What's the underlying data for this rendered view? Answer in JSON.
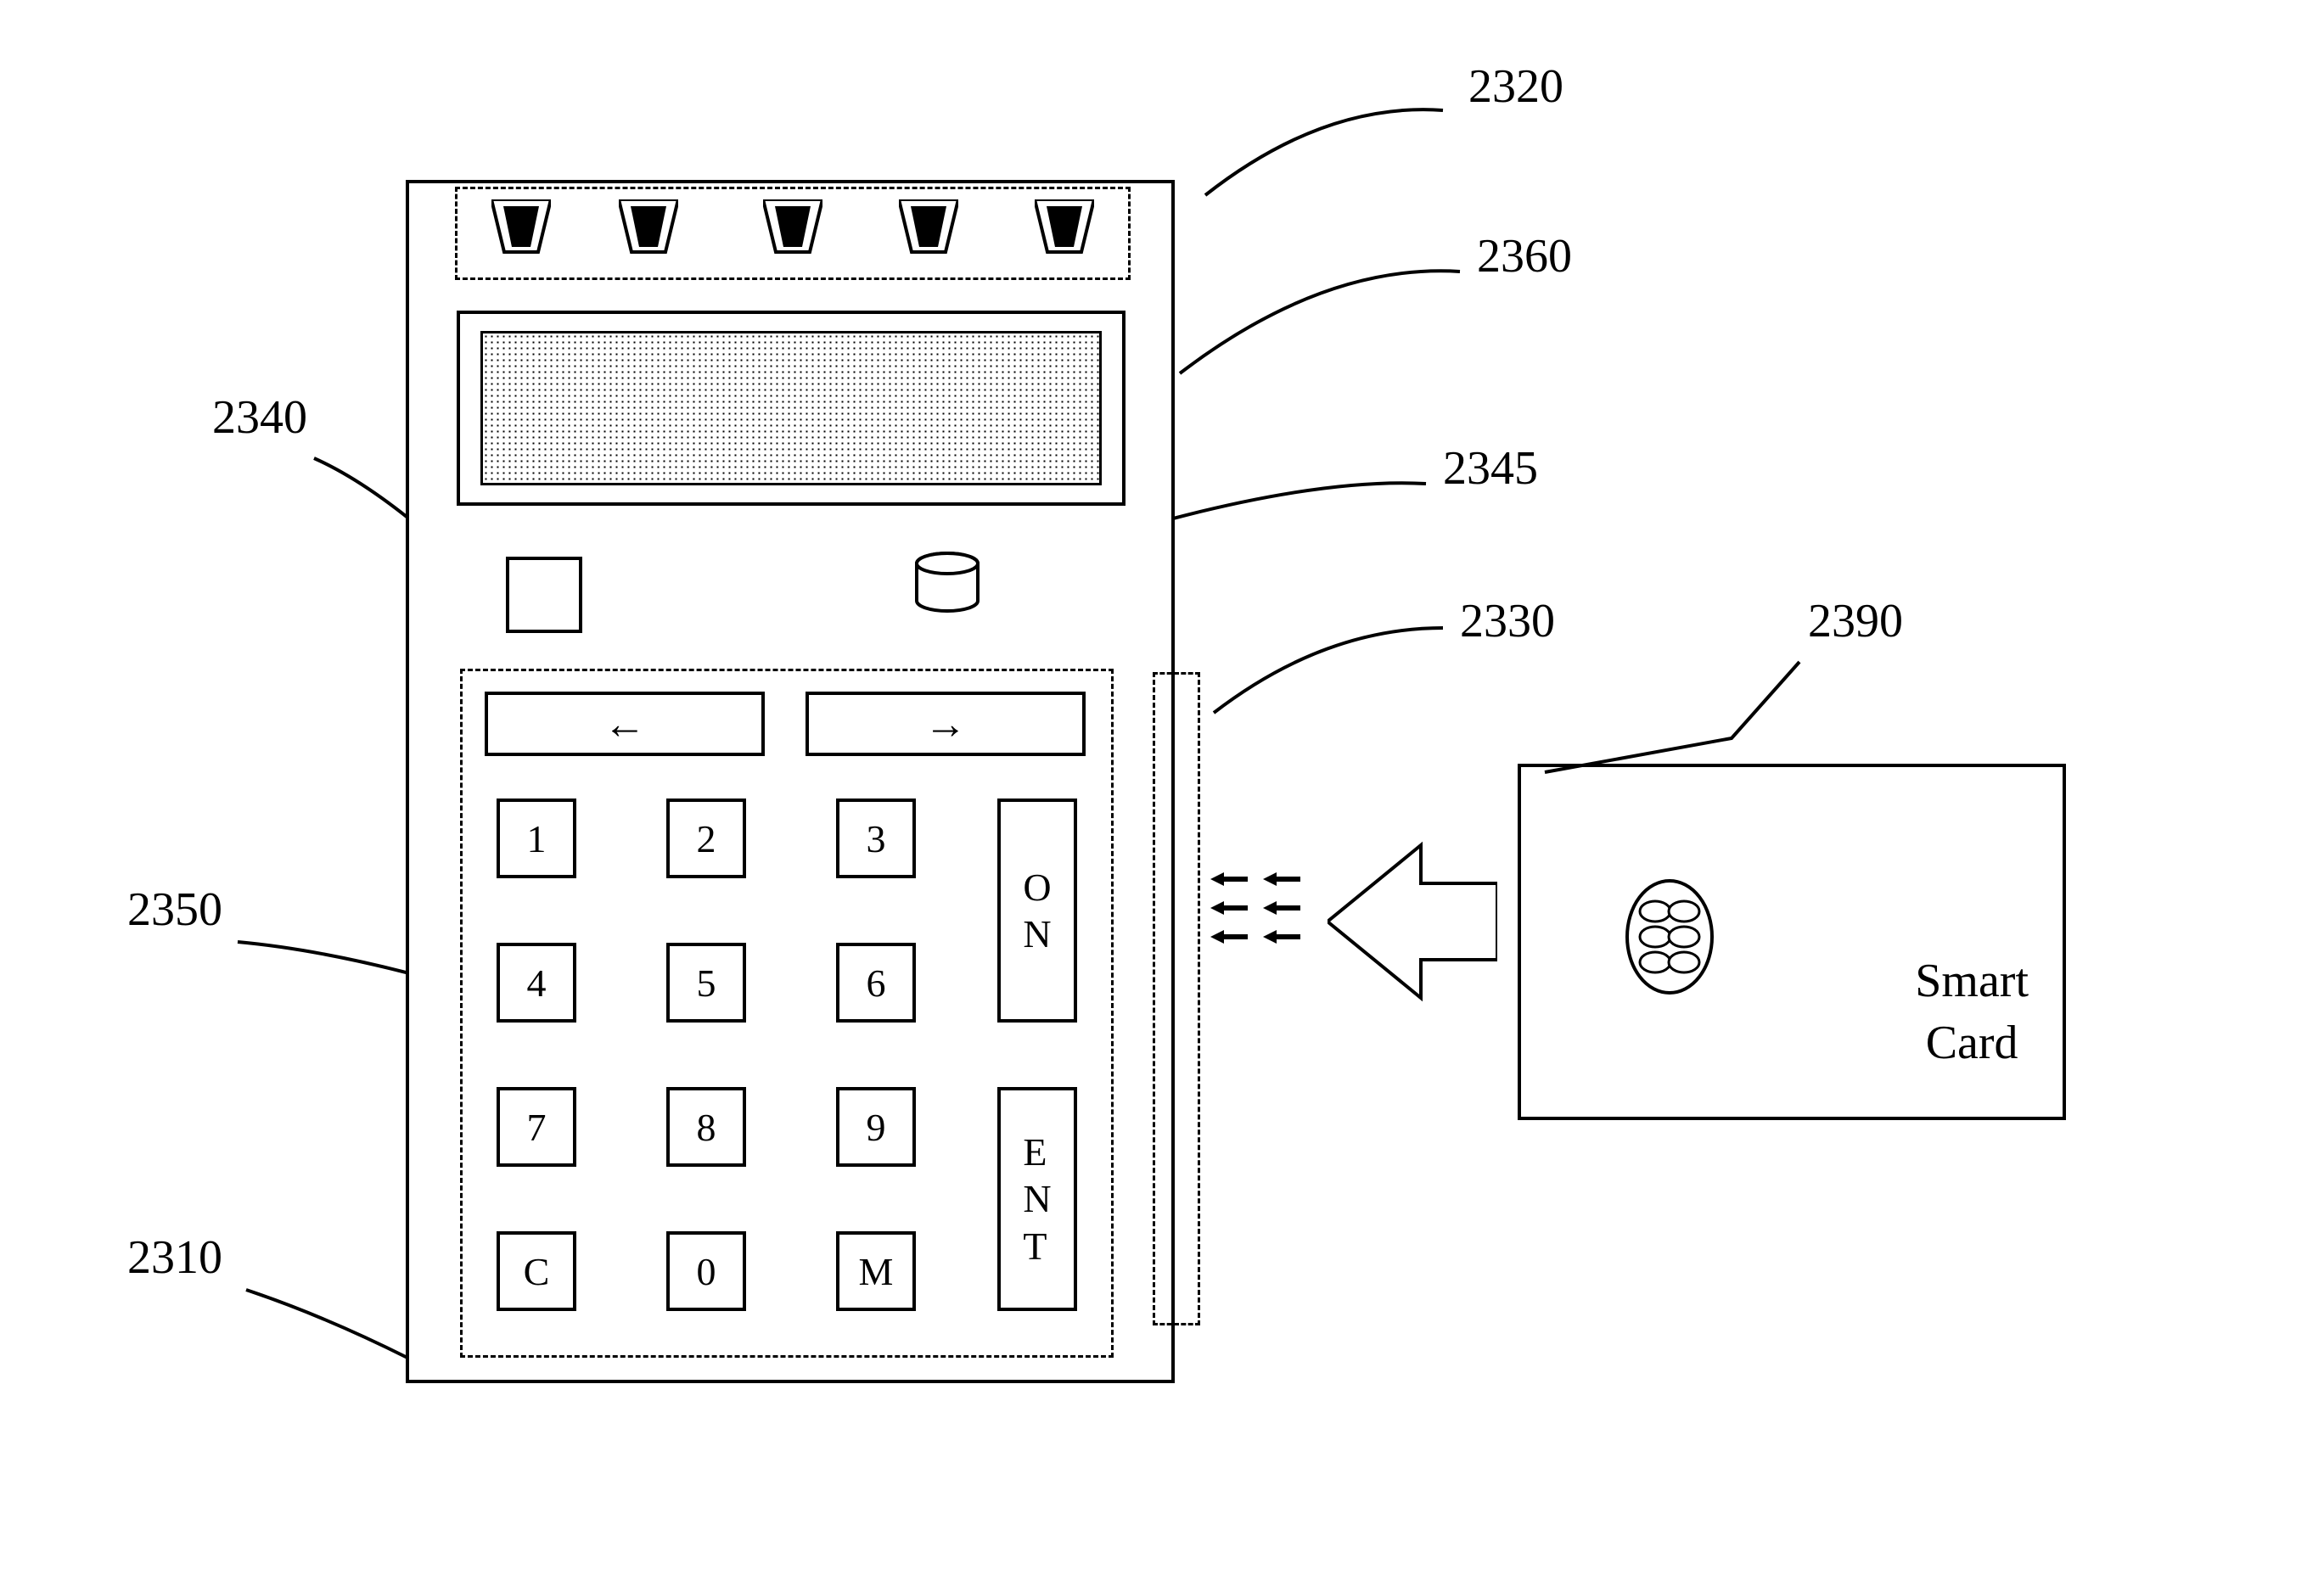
{
  "labels": {
    "l2310": "2310",
    "l2320": "2320",
    "l2330": "2330",
    "l2340": "2340",
    "l2345": "2345",
    "l2350": "2350",
    "l2360": "2360",
    "l2390": "2390"
  },
  "keypad": {
    "nav_left": "←",
    "nav_right": "→",
    "k1": "1",
    "k2": "2",
    "k3": "3",
    "k4": "4",
    "k5": "5",
    "k6": "6",
    "k7": "7",
    "k8": "8",
    "k9": "9",
    "kC": "C",
    "k0": "0",
    "kM": "M",
    "on": "O\nN",
    "ent": "E\nN\nT"
  },
  "card": {
    "text": "Smart\nCard"
  }
}
